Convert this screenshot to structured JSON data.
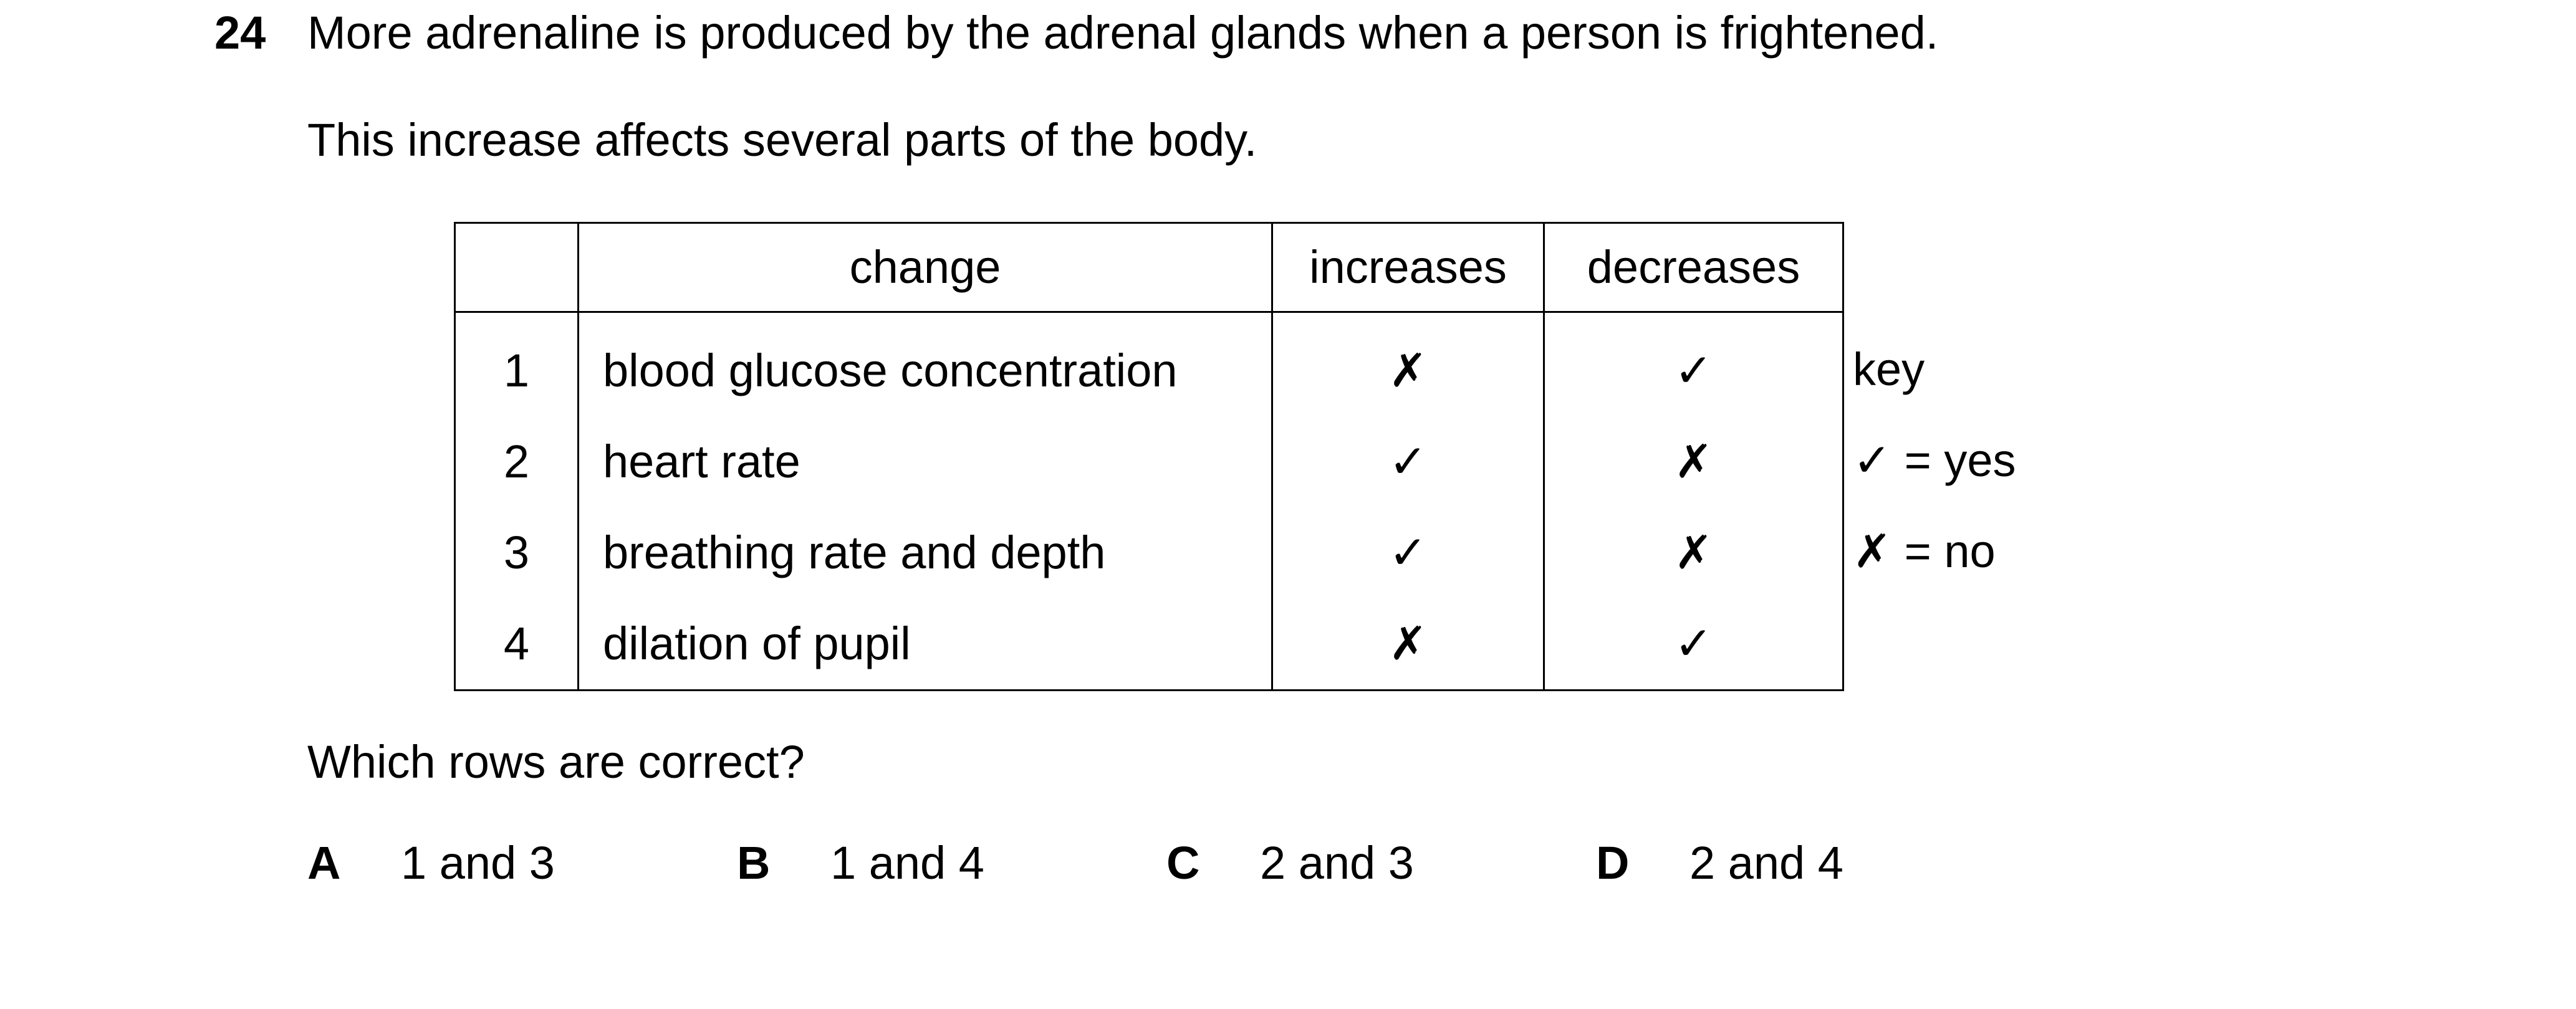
{
  "question": {
    "number": "24",
    "stem_line1": "More adrenaline is produced by the adrenal glands when a person is frightened.",
    "stem_line2": "This increase affects several parts of the body."
  },
  "table": {
    "headers": [
      "",
      "change",
      "increases",
      "decreases"
    ],
    "rows": [
      {
        "num": "1",
        "change": "blood glucose concentration",
        "increases": "✗",
        "decreases": "✓"
      },
      {
        "num": "2",
        "change": "heart rate",
        "increases": "✓",
        "decreases": "✗"
      },
      {
        "num": "3",
        "change": "breathing rate and depth",
        "increases": "✓",
        "decreases": "✗"
      },
      {
        "num": "4",
        "change": "dilation of pupil",
        "increases": "✗",
        "decreases": "✓"
      }
    ]
  },
  "key": {
    "title": "key",
    "yes": "✓ = yes",
    "no": "✗ = no"
  },
  "prompt": "Which rows are correct?",
  "options": [
    {
      "letter": "A",
      "text": "1 and 3"
    },
    {
      "letter": "B",
      "text": "1 and 4"
    },
    {
      "letter": "C",
      "text": "2 and 3"
    },
    {
      "letter": "D",
      "text": "2 and 4"
    }
  ]
}
